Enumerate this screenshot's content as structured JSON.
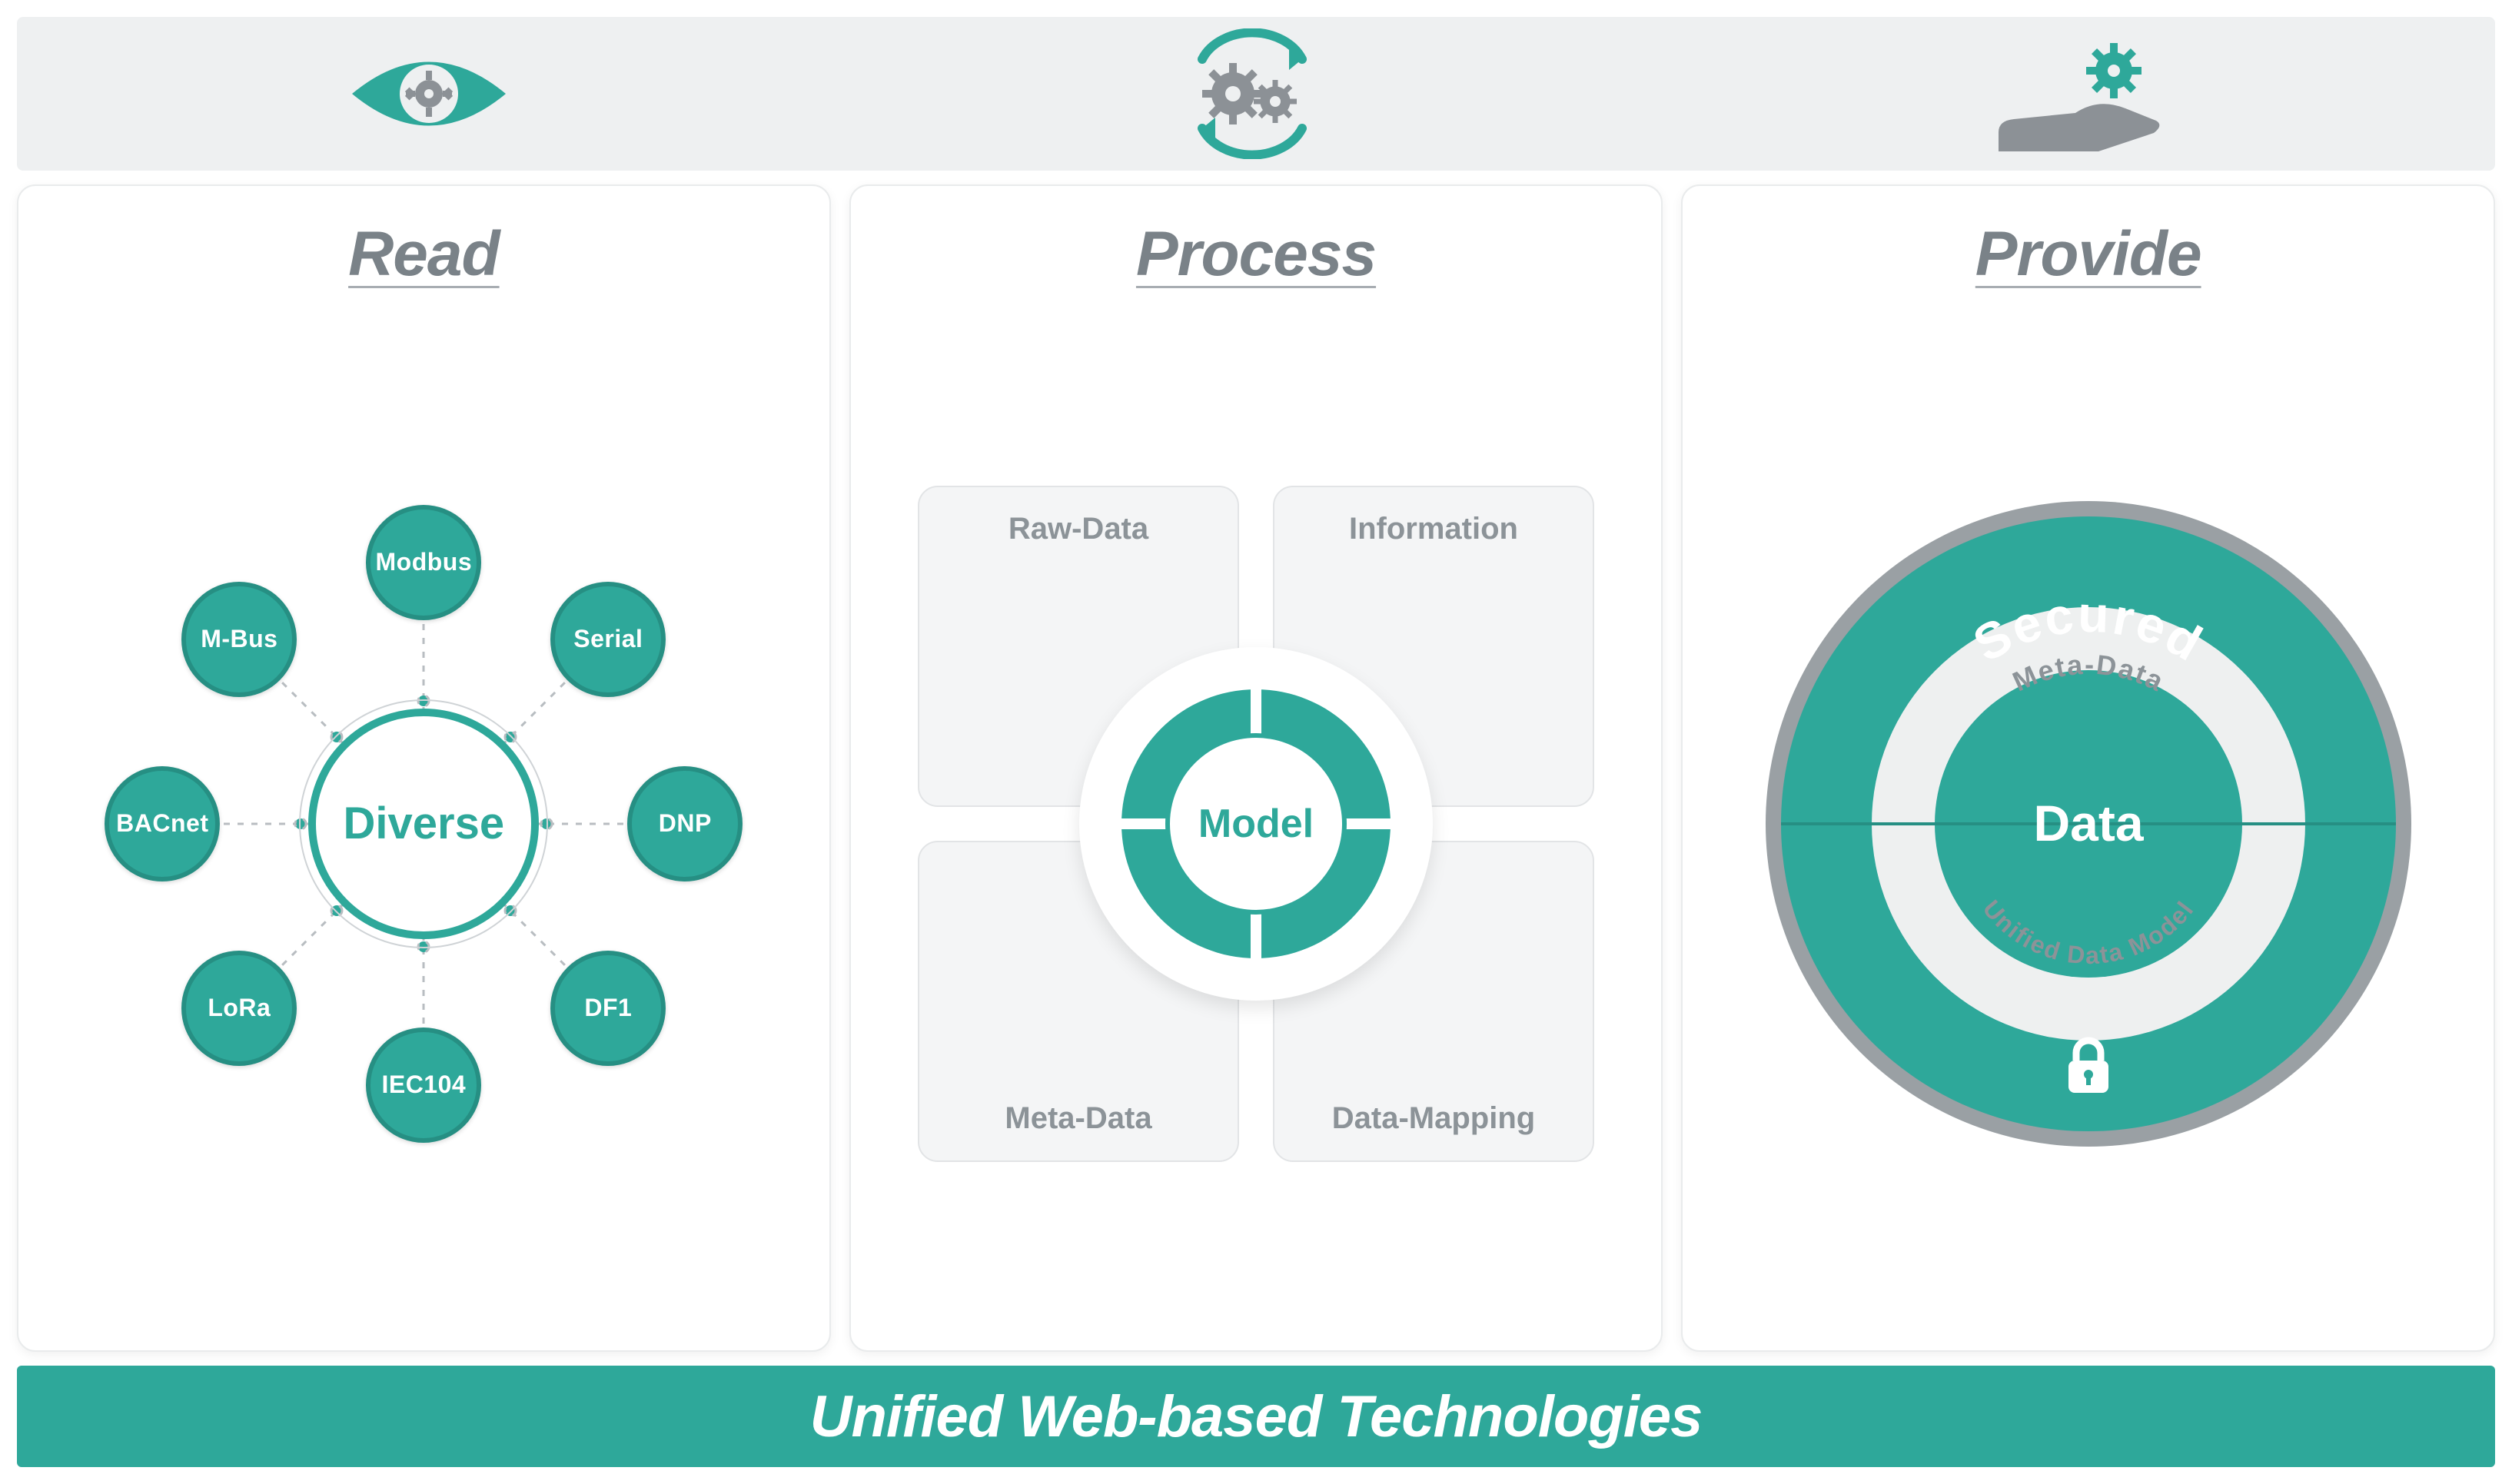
{
  "colors": {
    "teal": "#2ea89a",
    "grey": "#8c9196"
  },
  "iconbar": {
    "left": "eye-gear",
    "center": "gears-cycle",
    "right": "hand-gear"
  },
  "columns": {
    "read": {
      "title": "Read",
      "center": "Diverse",
      "nodes": [
        "Modbus",
        "Serial",
        "DNP",
        "DF1",
        "IEC104",
        "LoRa",
        "BACnet",
        "M-Bus"
      ]
    },
    "process": {
      "title": "Process",
      "center": "Model",
      "tiles": {
        "tl": "Raw-Data",
        "tr": "Information",
        "bl": "Meta-Data",
        "br": "Data-Mapping"
      }
    },
    "provide": {
      "title": "Provide",
      "outer": "Secured",
      "middle_top": "Meta-Data",
      "middle_bottom": "Unified Data Model",
      "center": "Data",
      "lock": "lock"
    }
  },
  "footer": "Unified Web-based Technologies"
}
